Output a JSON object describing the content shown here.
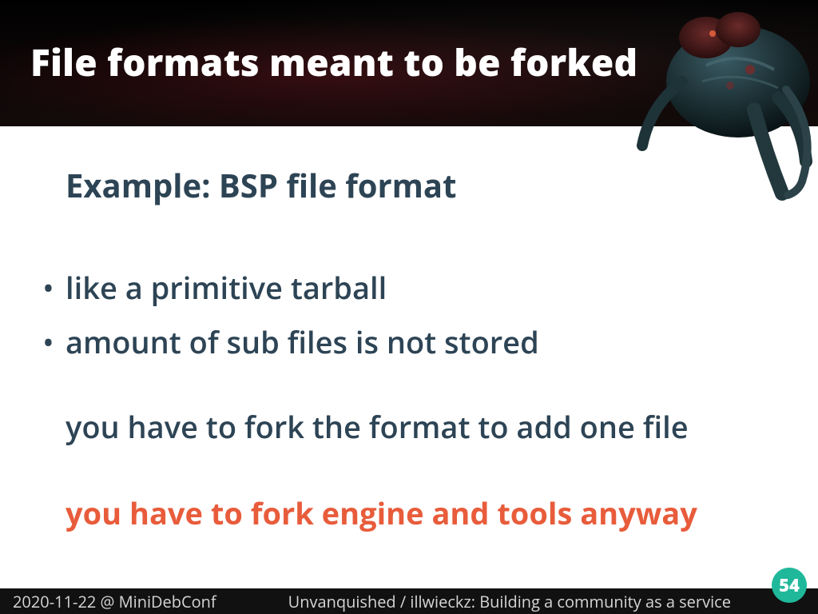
{
  "header": {
    "title": "File formats meant to be forked"
  },
  "content": {
    "subtitle": "Example: BSP file format",
    "bullets": [
      "like a primitive tarball",
      "amount of sub files is not stored"
    ],
    "line3": "you have to fork the format to add one file",
    "line4": "you have to fork engine and tools anyway"
  },
  "footer": {
    "date_venue": "2020-11-22 @ MiniDebConf",
    "talk": "Unvanquished / illwieckz: Building a community as a service"
  },
  "page_number": "54",
  "colors": {
    "accent_highlight": "#e85c3b",
    "text_body": "#2d4455",
    "page_badge": "#1fb89a"
  }
}
